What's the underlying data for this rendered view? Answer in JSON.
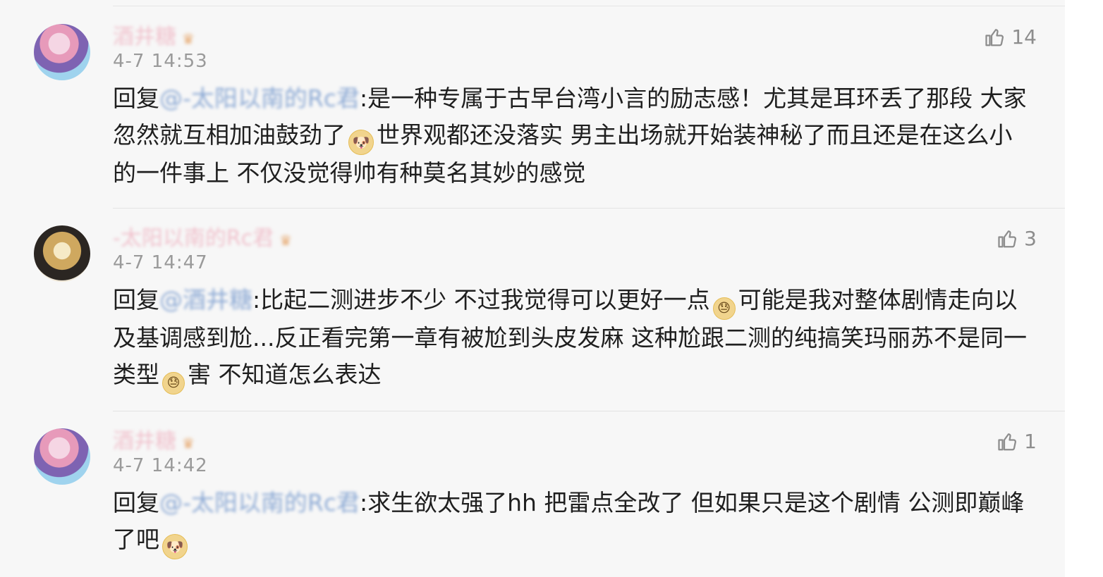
{
  "comments": [
    {
      "username": "酒井糖",
      "time": "4-7 14:53",
      "likes": "14",
      "reply_prefix": "回复",
      "mention": "@-太阳以南的Rc君",
      "text_1": ":是一种专属于古早台湾小言的励志感！尤其是耳环丢了那段 大家忽然就互相加油鼓劲了",
      "emoji_1": "doge-emoji",
      "text_2": "世界观都还没落实 男主出场就开始装神秘了而且还是在这么小的一件事上 不仅没觉得帅有种莫名其妙的感觉"
    },
    {
      "username": "-太阳以南的Rc君",
      "time": "4-7 14:47",
      "likes": "3",
      "reply_prefix": "回复",
      "mention": "@酒井糖",
      "text_1": ":比起二测进步不少 不过我觉得可以更好一点",
      "emoji_1": "awkward-emoji",
      "text_2": "可能是我对整体剧情走向以及基调感到尬...反正看完第一章有被尬到头皮发麻 这种尬跟二测的纯搞笑玛丽苏不是同一类型",
      "emoji_2": "awkward-emoji",
      "text_3": "害 不知道怎么表达"
    },
    {
      "username": "酒井糖",
      "time": "4-7 14:42",
      "likes": "1",
      "reply_prefix": "回复",
      "mention": "@-太阳以南的Rc君",
      "text_1": ":求生欲太强了hh 把雷点全改了 但如果只是这个剧情 公测即巅峰了吧",
      "emoji_1": "doge-emoji"
    }
  ],
  "colors": {
    "mention": "#5f89c6",
    "body": "#1f1f1f",
    "meta": "#9a9a9a",
    "like": "#8d8d8d"
  }
}
